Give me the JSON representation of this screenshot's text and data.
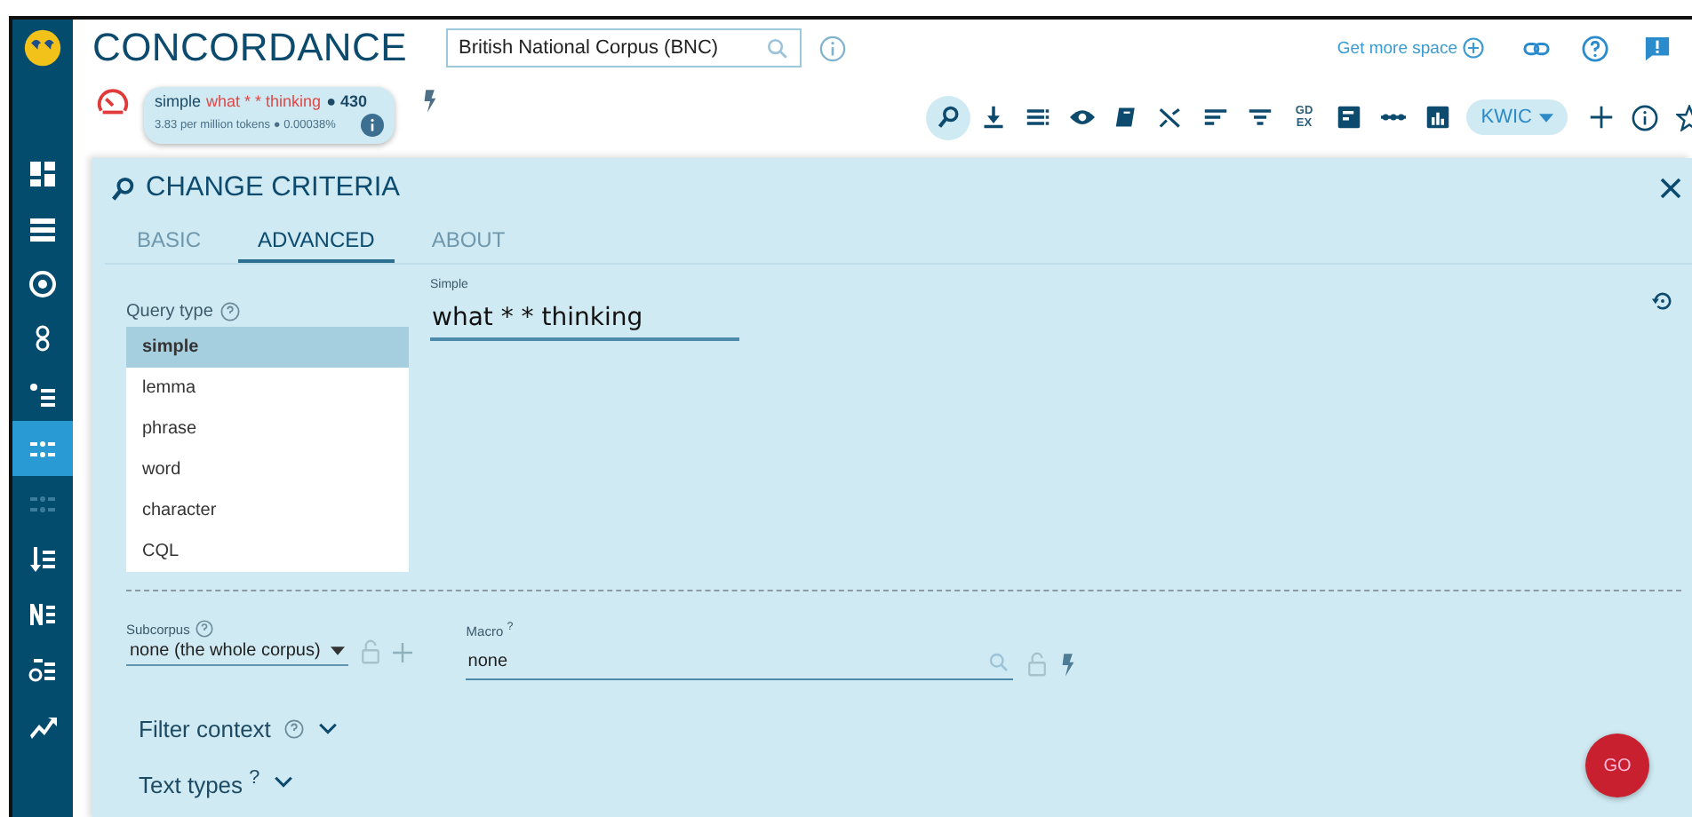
{
  "app": {
    "title": "CONCORDANCE"
  },
  "corpus_field": {
    "value": "British National Corpus (BNC)"
  },
  "top_links": {
    "more_space": "Get more space"
  },
  "sidebar": {
    "items": [
      {
        "selected": false,
        "disabled": false
      },
      {
        "selected": false,
        "disabled": false
      },
      {
        "selected": false,
        "disabled": false
      },
      {
        "selected": false,
        "disabled": false
      },
      {
        "selected": false,
        "disabled": false
      },
      {
        "selected": true,
        "disabled": false
      },
      {
        "selected": false,
        "disabled": true
      },
      {
        "selected": false,
        "disabled": false
      },
      {
        "selected": false,
        "disabled": false
      },
      {
        "selected": false,
        "disabled": false
      },
      {
        "selected": false,
        "disabled": false
      }
    ]
  },
  "query_summary": {
    "type": "simple",
    "query": "what * * thinking",
    "hits": "● 430",
    "stats": "3.83 per million tokens ● 0.00038%"
  },
  "toolbar": {
    "buttons": [
      {
        "selected": true
      },
      {
        "selected": false
      },
      {
        "selected": false
      },
      {
        "selected": false
      },
      {
        "selected": false
      },
      {
        "selected": false
      },
      {
        "selected": false
      },
      {
        "selected": false
      },
      {
        "selected": false
      },
      {
        "selected": false
      },
      {
        "selected": false
      },
      {
        "selected": false
      }
    ],
    "gdex_label": "GD EX",
    "view_mode": "KWIC"
  },
  "panel": {
    "title": "CHANGE CRITERIA",
    "tabs": [
      {
        "label": "BASIC",
        "selected": false
      },
      {
        "label": "ADVANCED",
        "selected": true
      },
      {
        "label": "ABOUT",
        "selected": false
      }
    ],
    "query_type_label": "Query type",
    "query_types": [
      {
        "label": "simple",
        "selected": true
      },
      {
        "label": "lemma",
        "selected": false
      },
      {
        "label": "phrase",
        "selected": false
      },
      {
        "label": "word",
        "selected": false
      },
      {
        "label": "character",
        "selected": false
      },
      {
        "label": "CQL",
        "selected": false
      }
    ],
    "query_field": {
      "label": "Simple",
      "value": "what * * thinking"
    },
    "subcorpus": {
      "label": "Subcorpus",
      "value": "none (the whole corpus)"
    },
    "macro": {
      "label": "Macro",
      "mark": "?",
      "value": "none"
    },
    "filter_context": "Filter context",
    "text_types": {
      "label": "Text types",
      "mark": "?"
    },
    "go_button": "GO"
  }
}
